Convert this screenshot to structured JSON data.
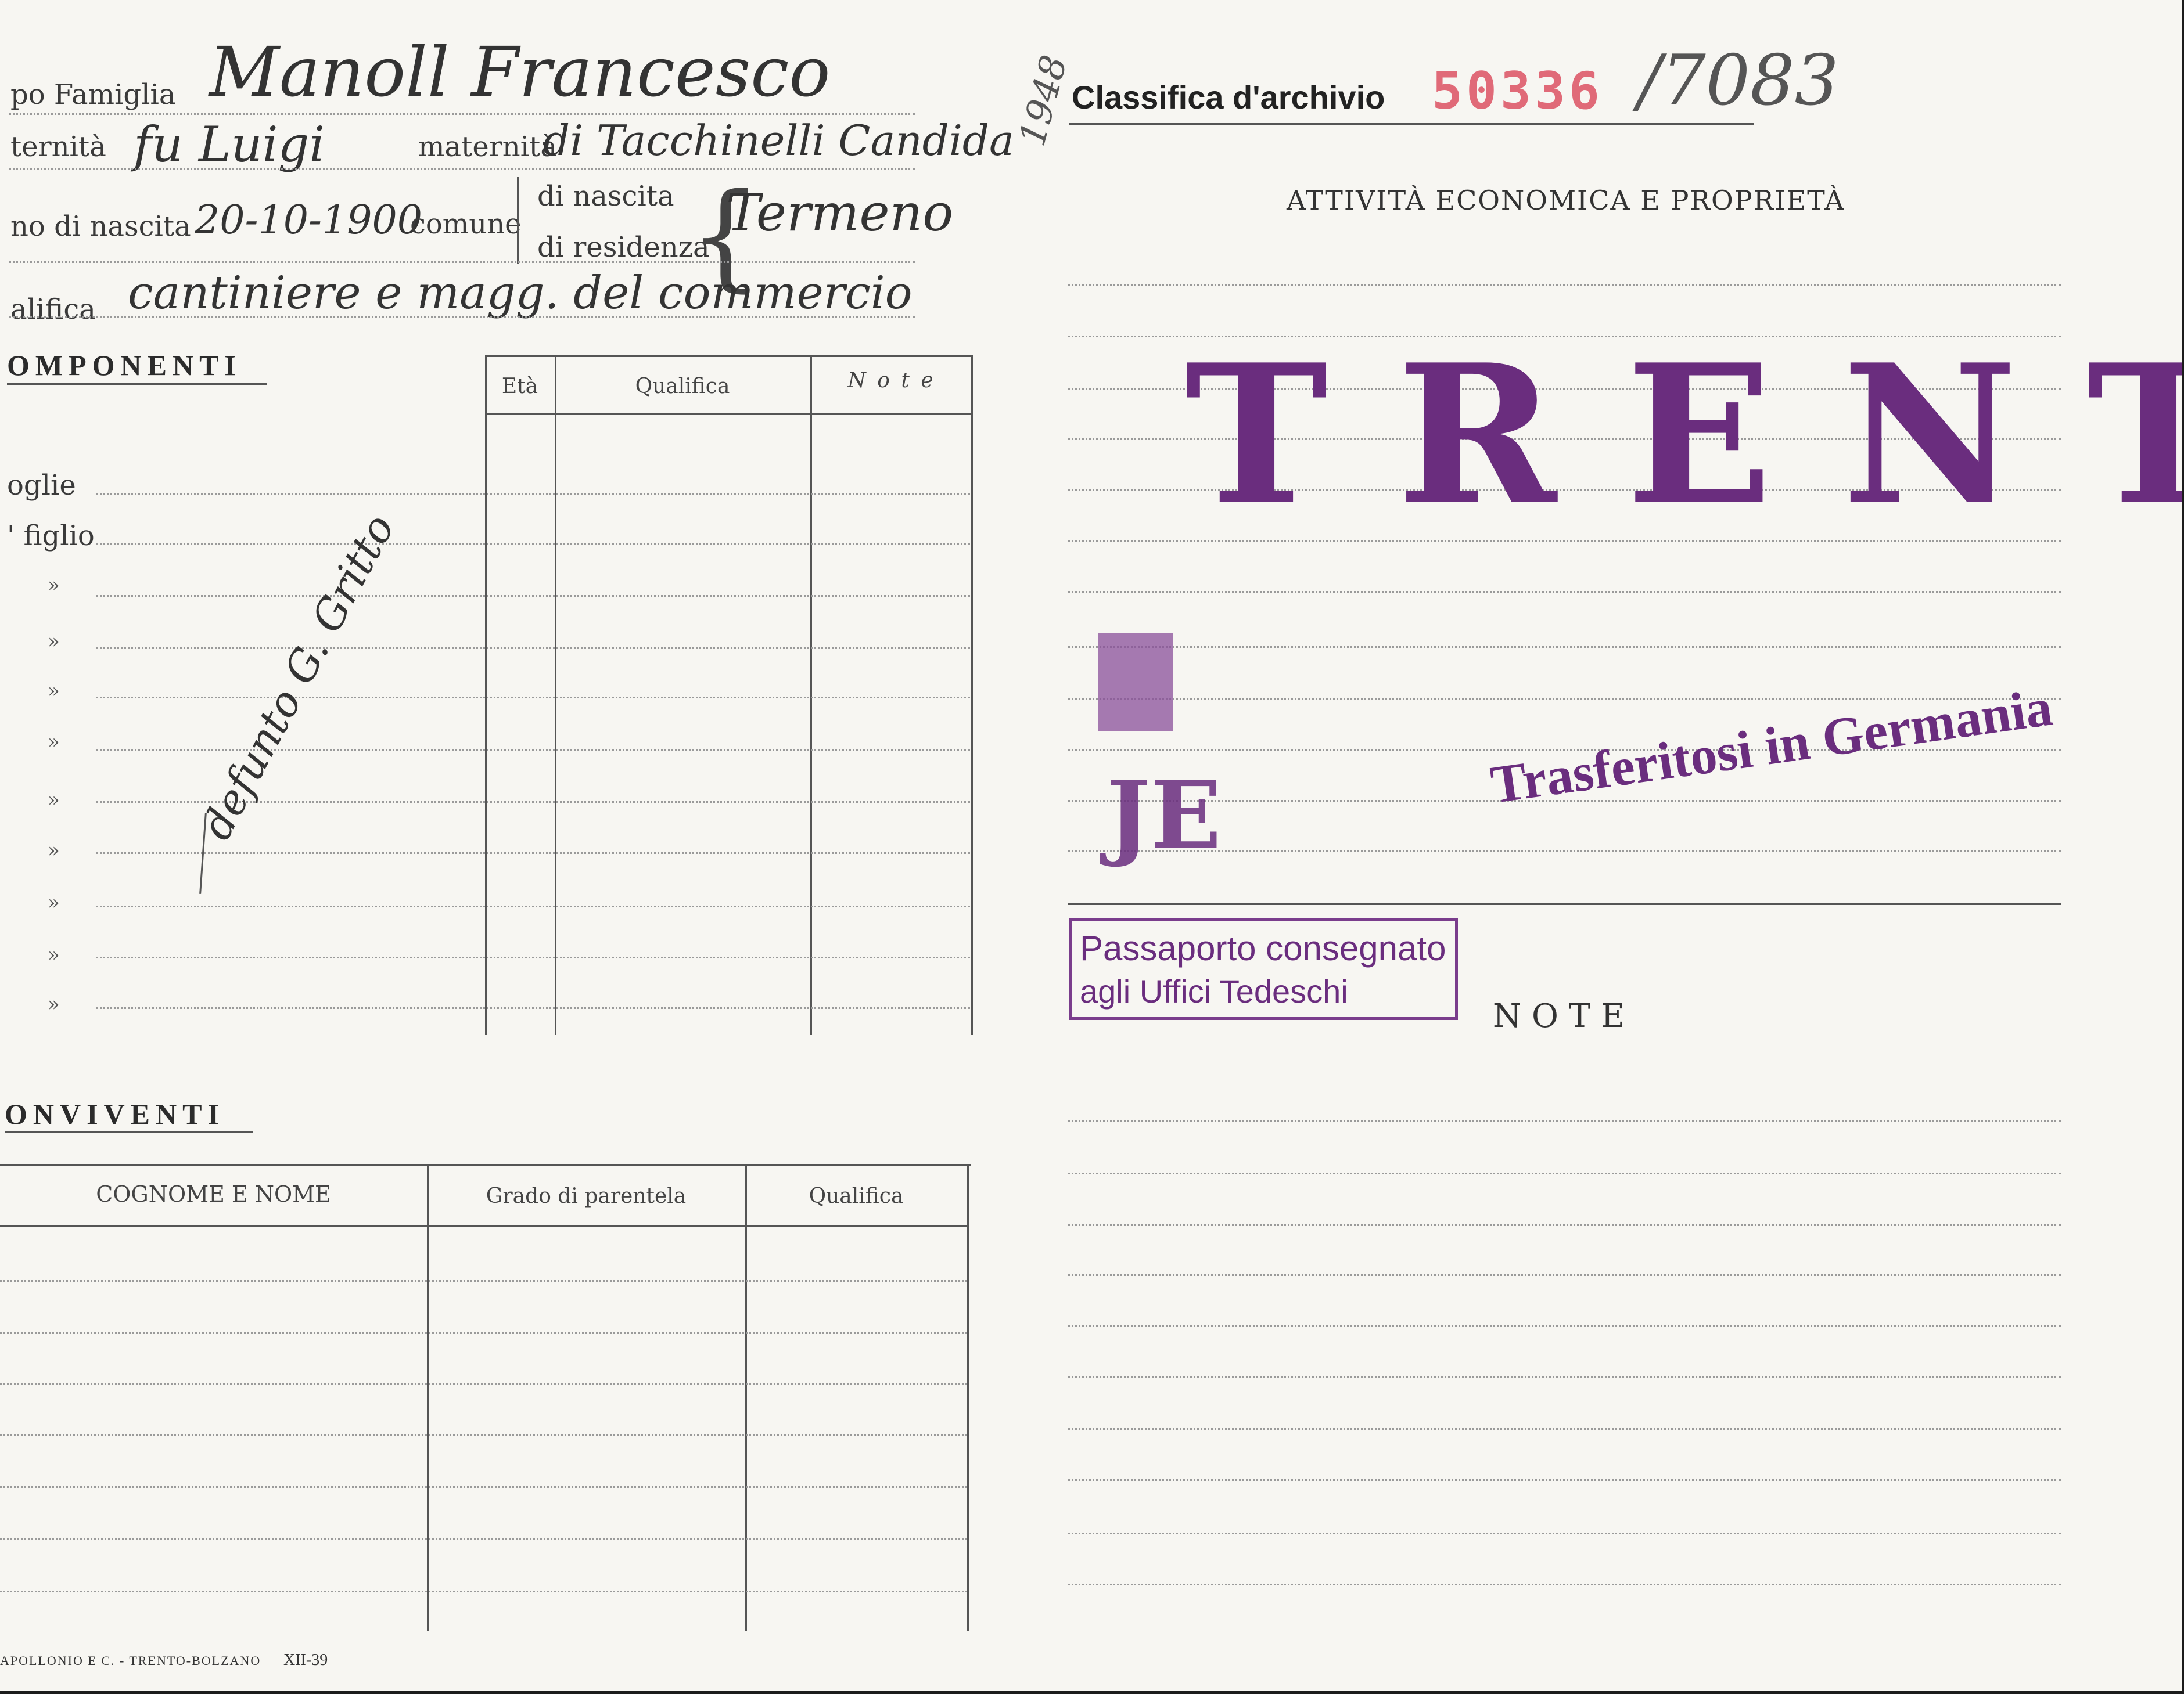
{
  "header": {
    "capo_famiglia_label": "po Famiglia",
    "capo_famiglia_value": "Manoll Francesco",
    "paternita_label": "ternità",
    "paternita_value": "fu Luigi",
    "maternita_label": "maternità",
    "maternita_value": "di Tacchinelli Candida",
    "nascita_label": "no di nascita",
    "nascita_value": "20-10-1900",
    "comune_label": "comune",
    "di_nascita_label": "di nascita",
    "di_residenza_label": "di residenza",
    "comune_value": "Termeno",
    "year_note": "1948",
    "qualifica_label": "alifica",
    "qualifica_value": "cantiniere e magg. del commercio"
  },
  "archive": {
    "label": "Classifica d'archivio",
    "number": "50336",
    "handwritten_number": "/7083"
  },
  "economic": {
    "heading": "ATTIVITÀ ECONOMICA E PROPRIETÀ"
  },
  "componenti": {
    "heading": "OMPONENTI",
    "columns": [
      "Età",
      "Qualifica",
      "N o t e"
    ],
    "row_labels": [
      "oglie",
      "' figlio",
      "»",
      "»",
      "»",
      "»",
      "»",
      "»",
      "»",
      "»",
      "»"
    ],
    "side_note": "defunto G. Gritto"
  },
  "conviventi": {
    "heading": "ONVIVENTI",
    "columns": [
      "COGNOME E NOME",
      "Grado di parentela",
      "Qualifica"
    ]
  },
  "stamps": {
    "trento": "TRENTO",
    "partial": "JE",
    "trasferiti": "Trasferitosi in Germania",
    "passaporto_line1": "Passaporto consegnato",
    "passaporto_line2": "agli Uffici Tedeschi"
  },
  "note": {
    "heading": "NOTE"
  },
  "footer": {
    "printer": "APOLLONIO E C. - TRENTO-BOLZANO",
    "code": "XII-39"
  },
  "colors": {
    "stamp_purple": "#6a2d7e",
    "archive_red": "#e06a78",
    "paper": "#f7f6f2"
  }
}
